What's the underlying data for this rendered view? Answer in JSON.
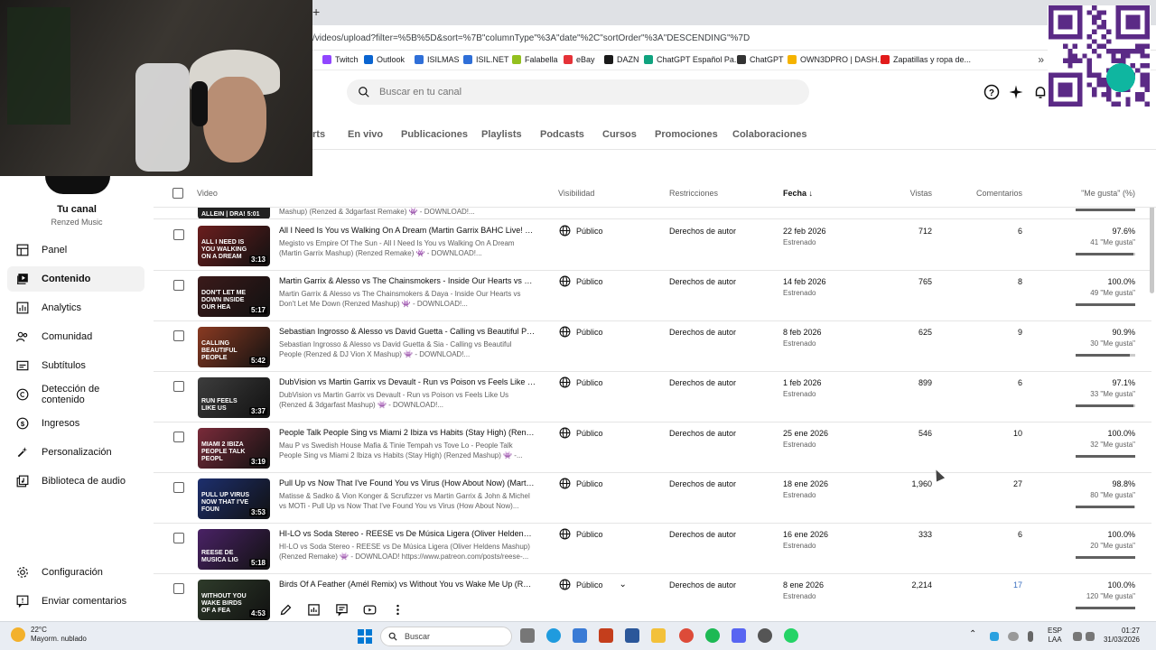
{
  "browser": {
    "new_tab_symbol": "+",
    "url": "/videos/upload?filter=%5B%5D&sort=%7B\"columnType\"%3A\"date\"%2C\"sortOrder\"%3A\"DESCENDING\"%7D",
    "bookmarks": [
      {
        "label": "Twitch",
        "color": "#9146ff"
      },
      {
        "label": "Outlook",
        "color": "#0a64d0"
      },
      {
        "label": "ISILMAS",
        "color": "#2f6fd8"
      },
      {
        "label": "ISIL.NET",
        "color": "#2f6fd8"
      },
      {
        "label": "Falabella",
        "color": "#93c01f"
      },
      {
        "label": "eBay",
        "color": "#e53238"
      },
      {
        "label": "DAZN",
        "color": "#1a1a1a"
      },
      {
        "label": "ChatGPT Español Pa...",
        "color": "#10a37f"
      },
      {
        "label": "ChatGPT",
        "color": "#333333"
      },
      {
        "label": "OWN3DPRO | DASH...",
        "color": "#f5b300"
      },
      {
        "label": "Zapatillas y ropa de...",
        "color": "#e21b1b"
      }
    ],
    "more_bookmarks": "»"
  },
  "header": {
    "search_placeholder": "Buscar en tu canal"
  },
  "tabs": [
    {
      "label": "rts"
    },
    {
      "label": "En vivo"
    },
    {
      "label": "Publicaciones"
    },
    {
      "label": "Playlists"
    },
    {
      "label": "Podcasts"
    },
    {
      "label": "Cursos"
    },
    {
      "label": "Promociones"
    },
    {
      "label": "Colaboraciones"
    }
  ],
  "sidebar": {
    "channel_title": "Tu canal",
    "channel_name": "Renzed Music",
    "items": [
      {
        "label": "Panel",
        "icon": "dashboard-icon"
      },
      {
        "label": "Contenido",
        "icon": "content-icon",
        "active": true
      },
      {
        "label": "Analytics",
        "icon": "analytics-icon"
      },
      {
        "label": "Comunidad",
        "icon": "community-icon"
      },
      {
        "label": "Subtítulos",
        "icon": "subtitles-icon"
      },
      {
        "label": "Detección de contenido",
        "icon": "copyright-icon"
      },
      {
        "label": "Ingresos",
        "icon": "earn-icon"
      },
      {
        "label": "Personalización",
        "icon": "customize-icon"
      },
      {
        "label": "Biblioteca de audio",
        "icon": "audio-library-icon"
      }
    ],
    "bottom_items": [
      {
        "label": "Configuración",
        "icon": "settings-icon"
      },
      {
        "label": "Enviar comentarios",
        "icon": "feedback-icon"
      }
    ]
  },
  "table": {
    "headers": {
      "video": "Video",
      "visibility": "Visibilidad",
      "restrictions": "Restricciones",
      "date": "Fecha",
      "views": "Vistas",
      "comments": "Comentarios",
      "likes": "\"Me gusta\" (%)"
    },
    "partial_row": {
      "caption": "ALLEIN | DRA! 5:01",
      "desc": "Mashup) (Renzed & 3dgarfast Remake) 👾 - DOWNLOAD!..."
    },
    "rows": [
      {
        "title": "All I Need Is You vs Walking On A Dream (Martin Garrix BAHC Live! 2026...",
        "desc": "Megisto vs Empire Of The Sun - All I Need Is You vs Walking On A Dream (Martin Garrix Mashup) (Renzed Remake) 👾 - DOWNLOAD!...",
        "caption": "ALL I NEED IS YOU WALKING ON A DREAM",
        "duration": "3:13",
        "visibility": "Público",
        "restriction": "Derechos de autor",
        "date": "22 feb 2026",
        "date_sub": "Estrenado",
        "views": "712",
        "comments": "6",
        "likes_pct": "97.6%",
        "likes_count": "41 \"Me gusta\"",
        "likes_fraction": 0.976,
        "thumb_color": "#6b1e1e"
      },
      {
        "title": "Martin Garrix & Alesso vs The Chainsmokers - Inside Our Hearts vs Don'...",
        "desc": "Martin Garrix & Alesso vs The Chainsmokers & Daya - Inside Our Hearts vs Don't Let Me Down (Renzed Mashup) 👾 - DOWNLOAD!...",
        "caption": "DON'T LET ME DOWN INSIDE OUR HEA",
        "duration": "5:17",
        "visibility": "Público",
        "restriction": "Derechos de autor",
        "date": "14 feb 2026",
        "date_sub": "Estrenado",
        "views": "765",
        "comments": "8",
        "likes_pct": "100.0%",
        "likes_count": "49 \"Me gusta\"",
        "likes_fraction": 1.0,
        "thumb_color": "#3b1a1a"
      },
      {
        "title": "Sebastian Ingrosso & Alesso vs David Guetta - Calling vs Beautiful Peop...",
        "desc": "Sebastian Ingrosso & Alesso vs David Guetta & Sia - Calling vs Beautiful People (Renzed & DJ Vion X Mashup) 👾 - DOWNLOAD!...",
        "caption": "CALLING BEAUTIFUL PEOPLE",
        "duration": "5:42",
        "visibility": "Público",
        "restriction": "Derechos de autor",
        "date": "8 feb 2026",
        "date_sub": "Estrenado",
        "views": "625",
        "comments": "9",
        "likes_pct": "90.9%",
        "likes_count": "30 \"Me gusta\"",
        "likes_fraction": 0.909,
        "thumb_color": "#8a3a22"
      },
      {
        "title": "DubVision vs Martin Garrix vs Devault - Run vs Poison vs Feels Like Us (...",
        "desc": "DubVision vs Martin Garrix vs Devault - Run vs Poison vs Feels Like Us (Renzed & 3dgarfast Mashup) 👾 - DOWNLOAD!...",
        "caption": "RUN FEELS LIKE US",
        "duration": "3:37",
        "visibility": "Público",
        "restriction": "Derechos de autor",
        "date": "1 feb 2026",
        "date_sub": "Estrenado",
        "views": "899",
        "comments": "6",
        "likes_pct": "97.1%",
        "likes_count": "33 \"Me gusta\"",
        "likes_fraction": 0.971,
        "thumb_color": "#3d3d3d"
      },
      {
        "title": "People Talk People Sing vs Miami 2 Ibiza vs Habits (Stay High) (Renzed ...",
        "desc": "Mau P vs Swedish House Mafia & Tinie Tempah vs Tove Lo - People Talk People Sing vs Miami 2 Ibiza vs Habits (Stay High) (Renzed Mashup) 👾 -...",
        "caption": "MIAMI 2 IBIZA PEOPLE TALK PEOPL",
        "duration": "3:19",
        "visibility": "Público",
        "restriction": "Derechos de autor",
        "date": "25 ene 2026",
        "date_sub": "Estrenado",
        "views": "546",
        "comments": "10",
        "likes_pct": "100.0%",
        "likes_count": "32 \"Me gusta\"",
        "likes_fraction": 1.0,
        "thumb_color": "#7a2b3a"
      },
      {
        "title": "Pull Up vs Now That I've Found You vs Virus (How About Now) (Martin ...",
        "desc": "Matisse & Sadko & Vion Konger & Scrufizzer vs Martin Garrix & John & Michel vs MOTi - Pull Up vs Now That I've Found You vs Virus (How About Now)...",
        "caption": "PULL UP VIRUS NOW THAT I'VE FOUN",
        "duration": "3:53",
        "visibility": "Público",
        "restriction": "Derechos de autor",
        "date": "18 ene 2026",
        "date_sub": "Estrenado",
        "views": "1,960",
        "comments": "27",
        "likes_pct": "98.8%",
        "likes_count": "80 \"Me gusta\"",
        "likes_fraction": 0.988,
        "thumb_color": "#1d2f6e"
      },
      {
        "title": "HI-LO vs Soda Stereo - REESE vs De Música Ligera (Oliver Heldens Ultra ...",
        "desc": "HI-LO vs Soda Stereo - REESE vs De Música Ligera (Oliver Heldens Mashup) (Renzed Remake) 👾 - DOWNLOAD! https://www.patreon.com/posts/reese-...",
        "caption": "REESE DE MUSICA LIG",
        "duration": "5:18",
        "visibility": "Público",
        "restriction": "Derechos de autor",
        "date": "16 ene 2026",
        "date_sub": "Estrenado",
        "views": "333",
        "comments": "6",
        "likes_pct": "100.0%",
        "likes_count": "20 \"Me gusta\"",
        "likes_fraction": 1.0,
        "thumb_color": "#4a2266"
      },
      {
        "title": "Birds Of A Feather (Amél Remix) vs Without You vs Wake Me Up (Renze...",
        "desc": "",
        "caption": "WITHOUT YOU WAKE BIRDS OF A FEA",
        "duration": "4:53",
        "visibility": "Público",
        "restriction": "Derechos de autor",
        "date": "8 ene 2026",
        "date_sub": "Estrenado",
        "views": "2,214",
        "comments": "17",
        "likes_pct": "100.0%",
        "likes_count": "120 \"Me gusta\"",
        "likes_fraction": 1.0,
        "thumb_color": "#2e3b2a",
        "hovered": true
      }
    ]
  },
  "taskbar": {
    "temperature": "22°C",
    "weather": "Mayorm. nublado",
    "search_label": "Buscar",
    "lang_line1": "ESP",
    "lang_line2": "LAA",
    "time": "01:27",
    "date": "31/03/2026"
  }
}
